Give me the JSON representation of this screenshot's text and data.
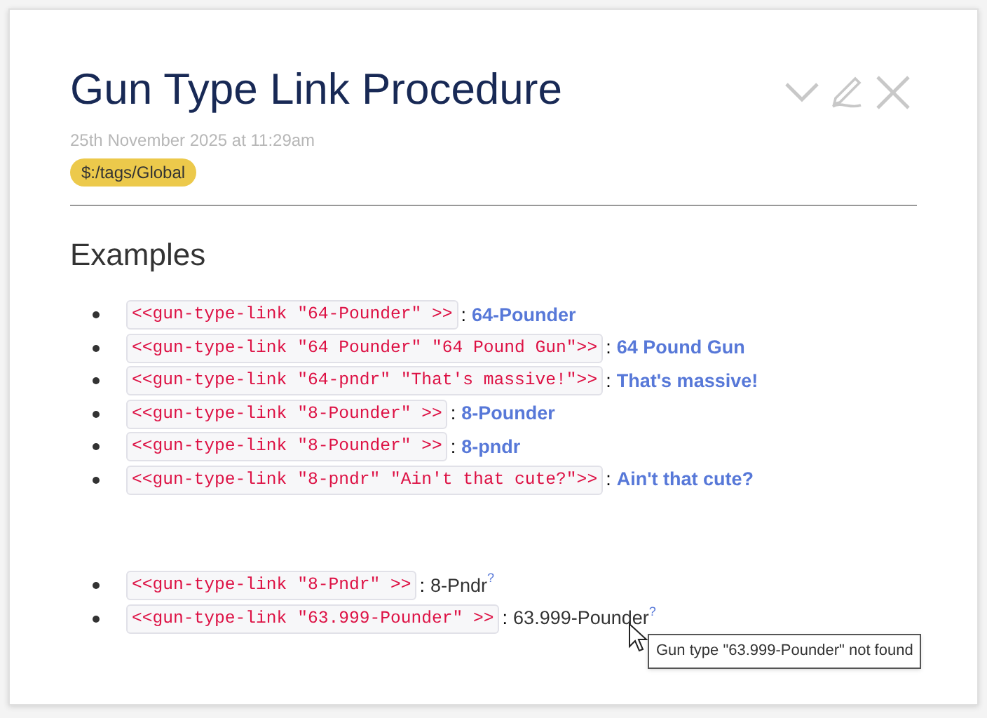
{
  "tiddler": {
    "title": "Gun Type Link Procedure",
    "modified": "25th November 2025 at 11:29am",
    "tags": [
      "$:/tags/Global"
    ]
  },
  "heading": "Examples",
  "lists": [
    [
      {
        "kind": "link",
        "code": "<<gun-type-link \"64-Pounder\" >>",
        "separator": ":",
        "result": "64-Pounder"
      },
      {
        "kind": "link",
        "code": "<<gun-type-link \"64 Pounder\" \"64 Pound Gun\">>",
        "separator": ":",
        "result": "64 Pound Gun"
      },
      {
        "kind": "link",
        "code": "<<gun-type-link \"64-pndr\" \"That's massive!\">>",
        "separator": ":",
        "result": "That's massive!"
      },
      {
        "kind": "link",
        "code": "<<gun-type-link \"8-Pounder\" >>",
        "separator": ":",
        "result": "8-Pounder"
      },
      {
        "kind": "link",
        "code": "<<gun-type-link \"8-Pounder\" >>",
        "separator": ":",
        "result": "8-pndr"
      },
      {
        "kind": "link",
        "code": "<<gun-type-link \"8-pndr\" \"Ain't that cute?\">>",
        "separator": ":",
        "result": "Ain't that cute?"
      }
    ],
    [
      {
        "kind": "missing",
        "code": "<<gun-type-link \"8-Pndr\" >>",
        "separator": ":",
        "result": "8-Pndr",
        "mark": "?"
      },
      {
        "kind": "missing",
        "code": "<<gun-type-link \"63.999-Pounder\" >>",
        "separator": ":",
        "result": "63.999-Pounder",
        "mark": "?"
      }
    ]
  ],
  "tooltip": "Gun type \"63.999-Pounder\" not found"
}
